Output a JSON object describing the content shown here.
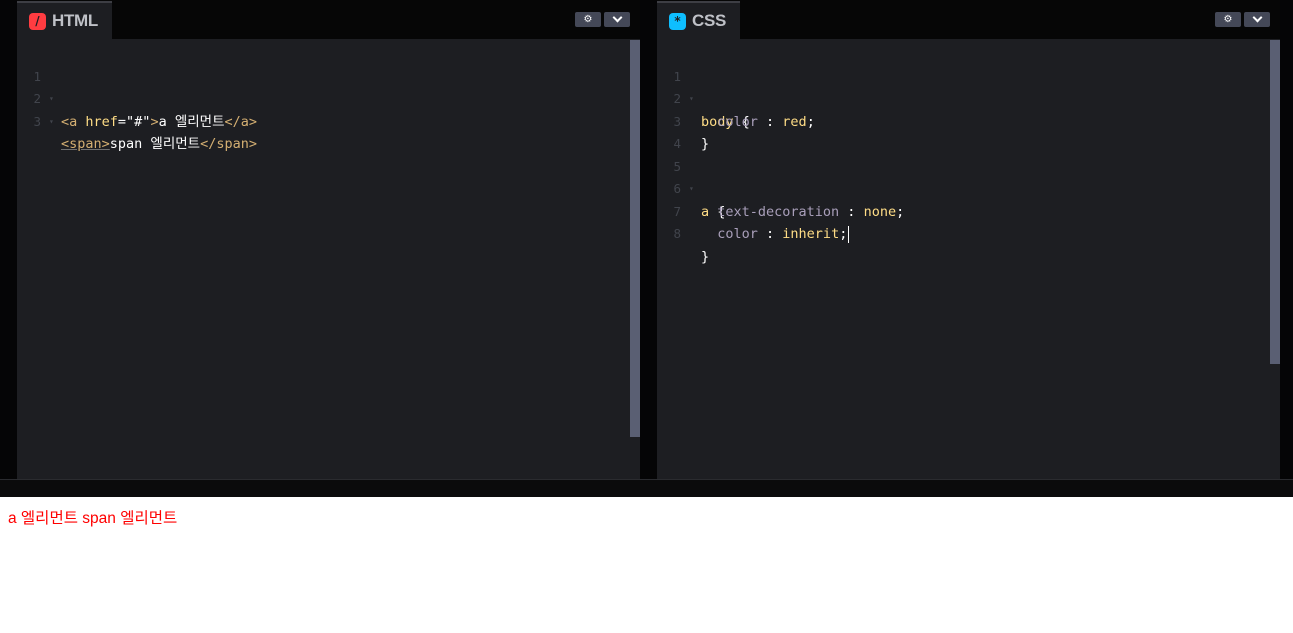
{
  "html_panel": {
    "tab_label": "HTML",
    "icon": "html-slash-icon",
    "icon_glyph": "/",
    "icon_color": "#ff3c41",
    "lines": [
      {
        "num": "1",
        "fold": "▾"
      },
      {
        "num": "2",
        "fold": "▾"
      },
      {
        "num": "3",
        "fold": ""
      }
    ],
    "code": {
      "l1_open": "<a",
      "l1_attr": " href",
      "l1_eq": "=",
      "l1_str": "\"#\"",
      "l1_close": ">",
      "l1_text": "a 엘리먼트",
      "l1_end": "</a>",
      "l2_open": "<span>",
      "l2_text": "span 엘리먼트",
      "l2_end": "</span>"
    }
  },
  "css_panel": {
    "tab_label": "CSS",
    "icon": "css-asterisk-icon",
    "icon_glyph": "*",
    "icon_color": "#0ebeff",
    "lines": [
      {
        "num": "1",
        "fold": "▾"
      },
      {
        "num": "2",
        "fold": ""
      },
      {
        "num": "3",
        "fold": ""
      },
      {
        "num": "4",
        "fold": ""
      },
      {
        "num": "5",
        "fold": "▾"
      },
      {
        "num": "6",
        "fold": ""
      },
      {
        "num": "7",
        "fold": ""
      },
      {
        "num": "8",
        "fold": ""
      }
    ],
    "code": {
      "l1_sel": "body",
      "l1_brace": " {",
      "l2_prop": "  color",
      "l2_colon": " : ",
      "l2_val": "red",
      "l2_semi": ";",
      "l3": "}",
      "l5_sel": "a",
      "l5_brace": " {",
      "l6_prop": "  text-decoration",
      "l6_colon": " : ",
      "l6_val": "none",
      "l6_semi": ";",
      "l7_prop": "  color",
      "l7_colon": " : ",
      "l7_val": "inherit",
      "l7_semi": ";",
      "l8": "}"
    }
  },
  "toolbar": {
    "settings_icon": "gear-icon",
    "gear_glyph": "⚙",
    "dropdown_icon": "chevron-down-icon"
  },
  "result": {
    "text": "a 엘리먼트 span 엘리먼트",
    "color": "#ff0000"
  }
}
